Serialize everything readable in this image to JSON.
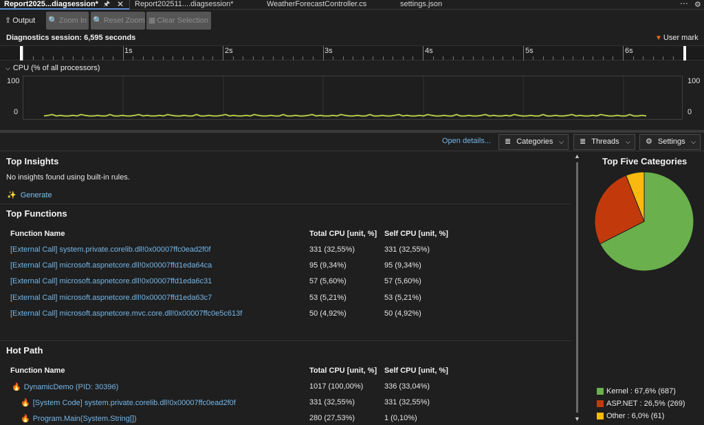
{
  "tabs": [
    {
      "label": "Report2025...diagsession*",
      "active": true
    },
    {
      "label": "Report202511....diagsession*"
    },
    {
      "label": "WeatherForecastController.cs"
    },
    {
      "label": "settings.json"
    }
  ],
  "toolbar": {
    "output": "Output",
    "zoom_in": "Zoom In",
    "reset_zoom": "Reset Zoom",
    "clear_selection": "Clear Selection"
  },
  "session": {
    "text": "Diagnostics session: 6,595 seconds",
    "user_mark": "User mark"
  },
  "ruler": {
    "labels": [
      "1s",
      "2s",
      "3s",
      "4s",
      "5s",
      "6s"
    ]
  },
  "cpu": {
    "title": "CPU (% of all processors)",
    "y_max": "100",
    "y_min": "0",
    "line_color": "#b5c84a"
  },
  "filters": {
    "open_details": "Open details...",
    "categories": "Categories",
    "threads": "Threads",
    "settings": "Settings"
  },
  "insights": {
    "title": "Top Insights",
    "message": "No insights found using built-in rules.",
    "generate": "Generate"
  },
  "top_functions": {
    "title": "Top Functions",
    "headers": {
      "name": "Function Name",
      "total": "Total CPU [unit, %]",
      "self": "Self CPU [unit, %]"
    },
    "rows": [
      {
        "name": "[External Call] system.private.corelib.dll!0x00007ffc0ead2f0f",
        "total": "331 (32,55%)",
        "self": "331 (32,55%)"
      },
      {
        "name": "[External Call] microsoft.aspnetcore.dll!0x00007ffd1eda64ca",
        "total": "95 (9,34%)",
        "self": "95 (9,34%)"
      },
      {
        "name": "[External Call] microsoft.aspnetcore.dll!0x00007ffd1eda6c31",
        "total": "57 (5,60%)",
        "self": "57 (5,60%)"
      },
      {
        "name": "[External Call] microsoft.aspnetcore.dll!0x00007ffd1eda63c7",
        "total": "53 (5,21%)",
        "self": "53 (5,21%)"
      },
      {
        "name": "[External Call] microsoft.aspnetcore.mvc.core.dll!0x00007ffc0e5c613f",
        "total": "50 (4,92%)",
        "self": "50 (4,92%)"
      }
    ]
  },
  "hot_path": {
    "title": "Hot Path",
    "headers": {
      "name": "Function Name",
      "total": "Total CPU [unit, %]",
      "self": "Self CPU [unit, %]"
    },
    "rows": [
      {
        "name": "DynamicDemo (PID: 30396)",
        "total": "1017 (100,00%)",
        "self": "336 (33,04%)"
      },
      {
        "name": "[System Code] system.private.corelib.dll!0x00007ffc0ead2f0f",
        "total": "331 (32,55%)",
        "self": "331 (32,55%)"
      },
      {
        "name": "Program.Main(System.String[])",
        "total": "280 (27,53%)",
        "self": "1 (0,10%)"
      }
    ]
  },
  "categories_chart": {
    "title": "Top Five Categories",
    "slices": [
      {
        "label": "Kernel : 67,6% (687)",
        "percent": 67.6,
        "color": "#6ab04c"
      },
      {
        "label": "ASP.NET : 26,5% (269)",
        "percent": 26.5,
        "color": "#c23a0c"
      },
      {
        "label": "Other : 6,0% (61)",
        "percent": 6.0,
        "color": "#f9b90f"
      }
    ]
  }
}
